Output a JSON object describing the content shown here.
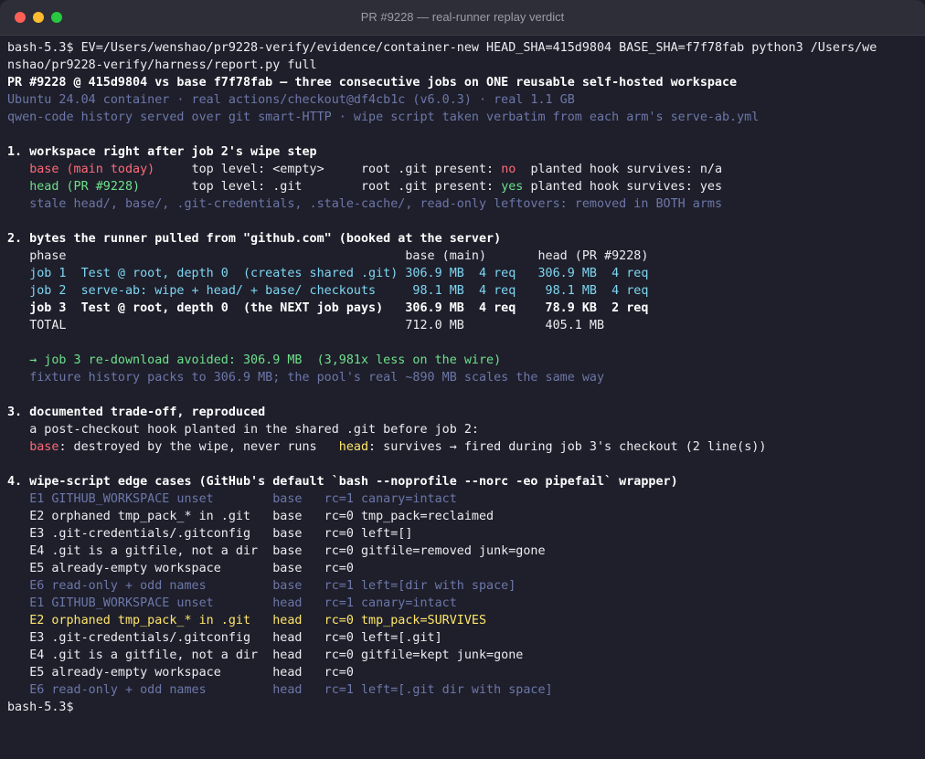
{
  "window": {
    "title": "PR #9228 — real-runner replay verdict"
  },
  "prompt": "bash-5.3$",
  "command": {
    "line1": " EV=/Users/wenshao/pr9228-verify/evidence/container-new HEAD_SHA=415d9804 BASE_SHA=f7f78fab python3 /Users/we",
    "line2": "nshao/pr9228-verify/harness/report.py full"
  },
  "report": {
    "header": "PR #9228 @ 415d9804 vs base f7f78fab — three consecutive jobs on ONE reusable self-hosted workspace",
    "env1": "Ubuntu 24.04 container · real actions/checkout@df4cb1c (v6.0.3) · real 1.1 GB",
    "env2": "qwen-code history served over git smart-HTTP · wipe script taken verbatim from each arm's serve-ab.yml",
    "s1": {
      "title": "1. workspace right after job 2's wipe step",
      "base_arm": "base",
      "base_tag": "(main today)",
      "base_top": "top level: <empty>",
      "git_label": "root .git present: ",
      "base_git": "no",
      "hook_label": "planted hook survives: ",
      "base_hook": "n/a",
      "head_arm": "head",
      "head_tag": "(PR #9228)",
      "head_top": "top level: .git",
      "head_git": "yes",
      "head_hook": "yes",
      "note": "stale head/, base/, .git-credentials, .stale-cache/, read-only leftovers: removed in BOTH arms"
    },
    "s2": {
      "title": "2. bytes the runner pulled from \"github.com\" (booked at the server)",
      "col_phase": "phase",
      "col_base": "base (main)",
      "col_head": "head (PR #9228)",
      "rows": [
        {
          "job": "job 1",
          "desc": "Test @ root, depth 0  (creates shared .git)",
          "base_val": "306.9 MB",
          "base_req": "4 req",
          "head_val": "306.9 MB",
          "head_req": "4 req"
        },
        {
          "job": "job 2",
          "desc": "serve-ab: wipe + head/ + base/ checkouts",
          "base_val": "98.1 MB",
          "base_req": "4 req",
          "head_val": "98.1 MB",
          "head_req": "4 req"
        },
        {
          "job": "job 3",
          "desc": "Test @ root, depth 0  (the NEXT job pays)",
          "base_val": "306.9 MB",
          "base_req": "4 req",
          "head_val": "78.9 KB",
          "head_req": "2 req"
        }
      ],
      "total_label": "TOTAL",
      "total_base": "712.0 MB",
      "total_head": "405.1 MB",
      "avoided": "→ job 3 re-download avoided: 306.9 MB  (3,981x less on the wire)",
      "fixture_note": "fixture history packs to 306.9 MB; the pool's real ~890 MB scales the same way"
    },
    "s3": {
      "title": "3. documented trade-off, reproduced",
      "line1": "a post-checkout hook planted in the shared .git before job 2:",
      "base_label": "base",
      "base_text": ": destroyed by the wipe, never runs",
      "head_label": "head",
      "head_text": ": survives → fired during job 3's checkout (2 line(s))"
    },
    "s4": {
      "title": "4. wipe-script edge cases (GitHub's default `bash --noprofile --norc -eo pipefail` wrapper)",
      "cases": [
        {
          "id": "E1",
          "name": "GITHUB_WORKSPACE unset",
          "arm": "base",
          "rc": "rc=1",
          "result": "canary=intact",
          "style": "dim"
        },
        {
          "id": "E2",
          "name": "orphaned tmp_pack_* in .git",
          "arm": "base",
          "rc": "rc=0",
          "result": "tmp_pack=reclaimed",
          "style": "w"
        },
        {
          "id": "E3",
          "name": ".git-credentials/.gitconfig",
          "arm": "base",
          "rc": "rc=0",
          "result": "left=[]",
          "style": "w"
        },
        {
          "id": "E4",
          "name": ".git is a gitfile, not a dir",
          "arm": "base",
          "rc": "rc=0",
          "result": "gitfile=removed junk=gone",
          "style": "w"
        },
        {
          "id": "E5",
          "name": "already-empty workspace",
          "arm": "base",
          "rc": "rc=0",
          "result": "",
          "style": "w"
        },
        {
          "id": "E6",
          "name": "read-only + odd names",
          "arm": "base",
          "rc": "rc=1",
          "result": "left=[dir with space]",
          "style": "dim"
        },
        {
          "id": "E1",
          "name": "GITHUB_WORKSPACE unset",
          "arm": "head",
          "rc": "rc=1",
          "result": "canary=intact",
          "style": "dim"
        },
        {
          "id": "E2",
          "name": "orphaned tmp_pack_* in .git",
          "arm": "head",
          "rc": "rc=0",
          "result": "tmp_pack=SURVIVES",
          "style": "yl"
        },
        {
          "id": "E3",
          "name": ".git-credentials/.gitconfig",
          "arm": "head",
          "rc": "rc=0",
          "result": "left=[.git]",
          "style": "w"
        },
        {
          "id": "E4",
          "name": ".git is a gitfile, not a dir",
          "arm": "head",
          "rc": "rc=0",
          "result": "gitfile=kept junk=gone",
          "style": "w"
        },
        {
          "id": "E5",
          "name": "already-empty workspace",
          "arm": "head",
          "rc": "rc=0",
          "result": "",
          "style": "w"
        },
        {
          "id": "E6",
          "name": "read-only + odd names",
          "arm": "head",
          "rc": "rc=1",
          "result": "left=[.git dir with space]",
          "style": "dim"
        }
      ]
    }
  },
  "colors": {
    "background": "#1e1f2b",
    "titlebar": "#2d2e37",
    "dim": "#6d77a8",
    "cyan": "#7fd6f2",
    "red": "#ff6a78",
    "green": "#6fe08a",
    "yellow": "#ffe66a"
  }
}
